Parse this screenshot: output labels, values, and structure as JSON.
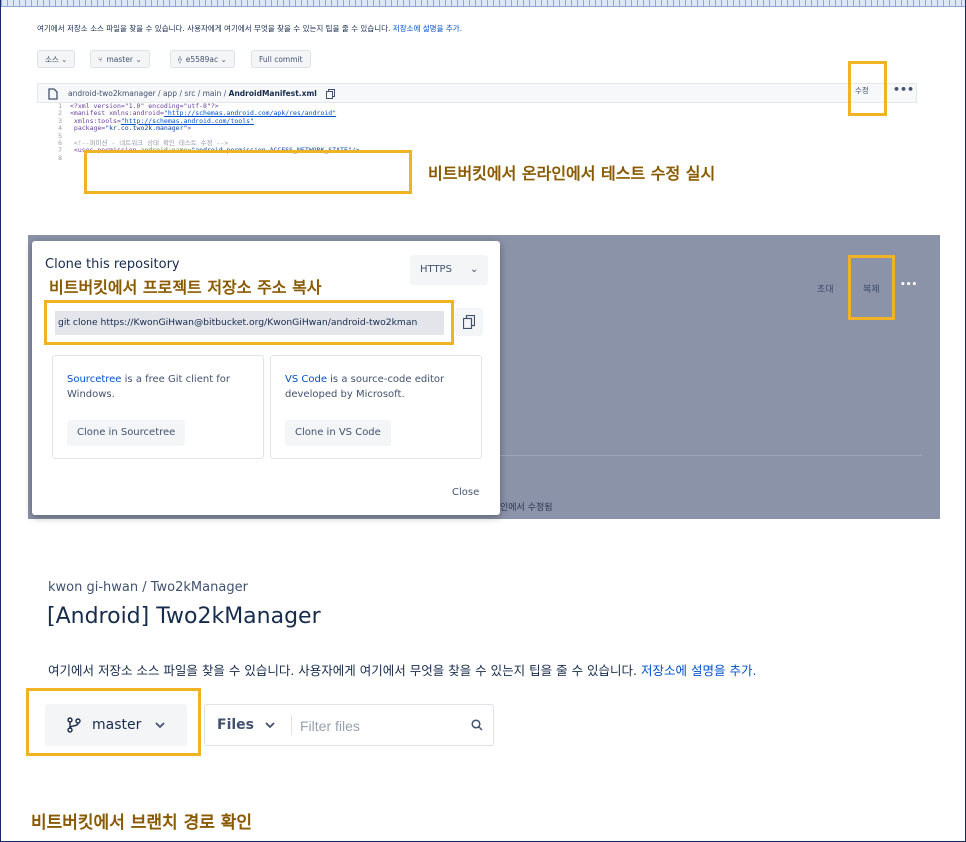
{
  "section1": {
    "description": "여기에서 저장소 소스 파일을 찾을 수 있습니다. 사용자에게 여기에서 무엇을 찾을 수 있는지 팁을 줄 수 있습니다. ",
    "description_link": "저장소에 설명을 추가.",
    "source_btn": "소스 ⌄",
    "branch_btn": "master ⌄",
    "commit_btn": "e5589ac ⌄",
    "full_commit_btn": "Full commit",
    "path": "android-two2kmanager / app / src / main / ",
    "filename": "AndroidManifest.xml",
    "edit_btn": "수정",
    "more": "•••",
    "code_lines": [
      {
        "n": "1",
        "parts": [
          {
            "t": "<?xml version=\"1.0\" encoding=\"utf-8\"?>",
            "c": "tk-purple"
          }
        ]
      },
      {
        "n": "2",
        "parts": [
          {
            "t": "<manifest xmlns:android=",
            "c": "tk-purple"
          },
          {
            "t": "\"http://schemas.android.com/apk/res/android\"",
            "c": "tk-link"
          }
        ]
      },
      {
        "n": "3",
        "parts": [
          {
            "t": "    xmlns:tools=",
            "c": "tk-purple"
          },
          {
            "t": "\"http://schemas.android.com/tools\"",
            "c": "tk-link"
          }
        ]
      },
      {
        "n": "4",
        "parts": [
          {
            "t": "    package=",
            "c": "tk-purple"
          },
          {
            "t": "\"kr.co.two2k.manager\"",
            "c": "tk-blue"
          },
          {
            "t": ">",
            "c": "tk-purple"
          }
        ]
      },
      {
        "n": "5",
        "parts": [
          {
            "t": "",
            "c": ""
          }
        ]
      },
      {
        "n": "6",
        "parts": [
          {
            "t": "    <!--퍼미션 - 네트워크 상태 확인 테스트 수정 -->",
            "c": "tk-grey"
          }
        ]
      },
      {
        "n": "7",
        "parts": [
          {
            "t": "    <uses-permission ",
            "c": "tk-purple"
          },
          {
            "t": "android:name=",
            "c": "tk-green"
          },
          {
            "t": "\"android.permission.ACCESS_NETWORK_STATE\"/>",
            "c": "tk-blue"
          }
        ]
      },
      {
        "n": "8",
        "parts": [
          {
            "t": "",
            "c": ""
          }
        ]
      }
    ],
    "annotation": "비트버킷에서 온라인에서 테스트 수정 실시"
  },
  "section2": {
    "dialog_title": "Clone this repository",
    "protocol": "HTTPS",
    "annotation": "비트버킷에서 프로젝트 저장소 주소 복사",
    "clone_command": "git clone https://KwonGiHwan@bitbucket.org/KwonGiHwan/android-two2kman",
    "card1_link": "Sourcetree",
    "card1_text": " is a free Git client for Windows.",
    "card1_btn": "Clone in Sourcetree",
    "card2_link": "VS Code",
    "card2_text": " is a source-code editor developed by Microsoft.",
    "card2_btn": "Clone in VS Code",
    "close_btn": "Close",
    "bg_invite": "초대",
    "bg_clone": "복제",
    "bg_more": "•••",
    "bg_text": "인에서 수정됨"
  },
  "section3": {
    "breadcrumb": "kwon gi-hwan  /  Two2kManager",
    "repo_title": "[Android] Two2kManager",
    "description": "여기에서 저장소 소스 파일을 찾을 수 있습니다. 사용자에게 여기에서 무엇을 찾을 수 있는지 팁을 줄 수 있습니다. ",
    "description_link": "저장소에 설명을 추가.",
    "branch": "master",
    "files_label": "Files",
    "filter_placeholder": "Filter files",
    "annotation": "비트버킷에서 브랜치 경로 확인"
  },
  "colors": {
    "highlight": "#f0b323",
    "annotation": "#8a5a00",
    "link": "#0052cc",
    "overlay": "#8b93a8"
  }
}
